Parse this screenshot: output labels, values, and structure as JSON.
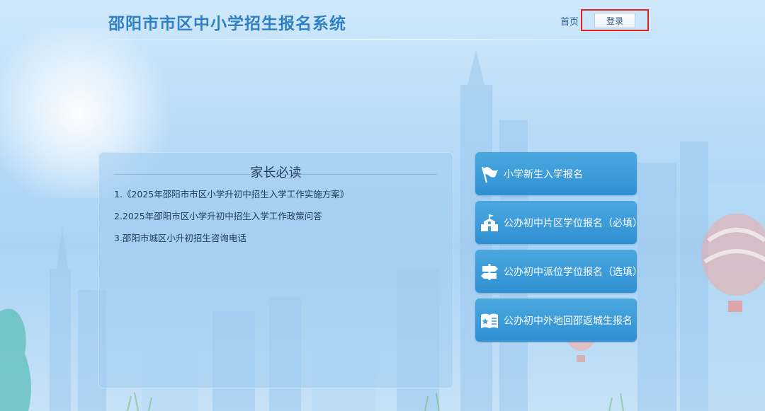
{
  "header": {
    "title": "邵阳市市区中小学招生报名系统",
    "nav_home": "首页",
    "login_label": "登录"
  },
  "notice": {
    "heading": "家长必读",
    "items": [
      "1.《2025年邵阳市市区小学升初中招生入学工作实施方案》",
      "2.2025年邵阳市区小学升初中招生入学工作政策问答",
      "3.邵阳市城区小升初招生咨询电话"
    ]
  },
  "actions": [
    {
      "label": "小学新生入学报名",
      "icon": "flag-icon"
    },
    {
      "label": "公办初中片区学位报名（必填）",
      "icon": "school-icon"
    },
    {
      "label": "公办初中派位学位报名（选填）",
      "icon": "signpost-icon"
    },
    {
      "label": "公办初中外地回邵返城生报名",
      "icon": "book-star-icon"
    }
  ],
  "colors": {
    "title": "#2c7fc8",
    "button_top": "#4ba8df",
    "button_bottom": "#2f90d3",
    "highlight": "#e3221e"
  }
}
